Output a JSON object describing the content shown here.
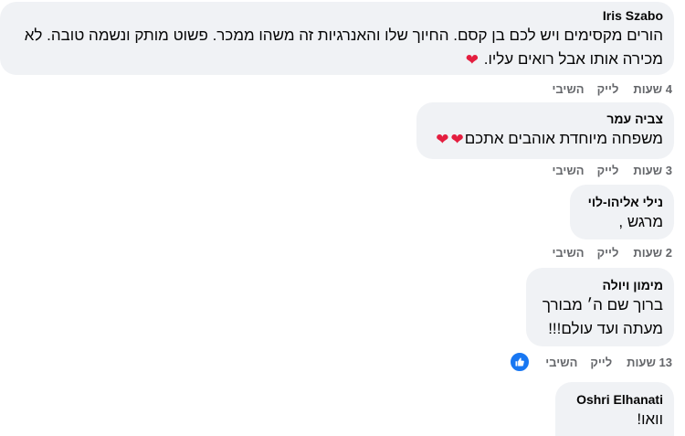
{
  "comments": [
    {
      "author": "Iris Szabo",
      "lines": [
        "הורים מקסימים ויש לכם בן קסם. החיוך שלו והאנרגיות זה משהו ממכר. פשוט מותק ונשמה טובה. לא",
        "מכירה אותו אבל רואים עליו."
      ],
      "hearts": 1,
      "time": "4 שעות",
      "like": "לייק",
      "reply": "השיבי"
    },
    {
      "author": "צביה עמר",
      "lines": [
        "משפחה מיוחדת אוהבים אתכם"
      ],
      "hearts": 2,
      "time": "3 שעות",
      "like": "לייק",
      "reply": "השיבי"
    },
    {
      "author": "נילי אליהו-לוי",
      "lines": [
        "מרגש ,"
      ],
      "hearts": 0,
      "time": "2 שעות",
      "like": "לייק",
      "reply": "השיבי"
    },
    {
      "author": "מימון ויולה",
      "lines": [
        "ברוך שם ה׳ מבורך",
        "מעתה ועד עולם!!!"
      ],
      "hearts": 0,
      "time": "13 שעות",
      "like": "לייק",
      "reply": "השיבי",
      "reaction": "like-icon"
    },
    {
      "author": "Oshri Elhanati",
      "lines": [
        "וואו!"
      ],
      "hearts": 0
    }
  ],
  "colors": {
    "bubble": "#f0f2f5",
    "action_text": "#65676b",
    "heart": "#e41e3f",
    "like_blue": "#1877f2"
  }
}
